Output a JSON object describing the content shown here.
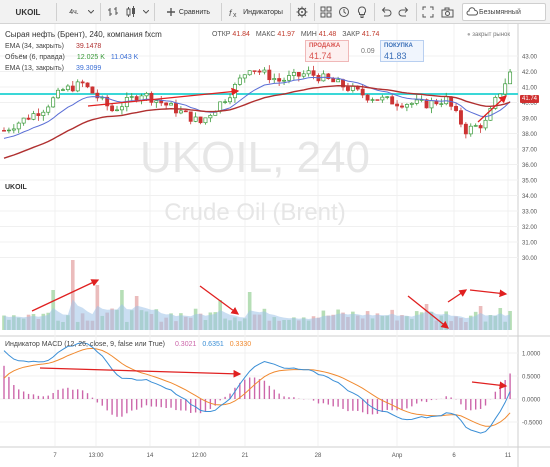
{
  "toolbar": {
    "symbol": "UKOIL",
    "interval": "4ч.",
    "compare": "Сравнить",
    "indicators": "Индикаторы",
    "unnamed": "Безымянный"
  },
  "main_pane": {
    "title": "Сырая нефть (Брент), 240, компания fxcm",
    "ohlc_open_label": "ОТКР",
    "ohlc_open": "41.84",
    "ohlc_high_label": "МАКС",
    "ohlc_high": "41.97",
    "ohlc_low_label": "МИН",
    "ohlc_low": "41.48",
    "ohlc_close_label": "ЗАКР",
    "ohlc_close": "41.74",
    "ema34_label": "EMA (34, закрыть)",
    "ema34_value": "39.1478",
    "volume_label": "Объём (6, правда)",
    "volume_value1": "12.025 K",
    "volume_value2": "11.043 K",
    "ema13_label": "EMA (13, закрыть)",
    "ema13_value": "39.3099",
    "sell_label": "ПРОДАЖА",
    "sell_price": "41.74",
    "spread": "0.09",
    "buy_label": "ПОКУПКА",
    "buy_price": "41.83",
    "market_status": "закрыт рынок",
    "last_price_tag": "41.74",
    "watermark_symbol": "UKOIL, 240",
    "watermark_name": "Crude Oil (Brent)",
    "symbol_tab": "UKOIL"
  },
  "macd_pane": {
    "label": "Индикатор MACD (12, 26, close, 9, false или True)",
    "value1": "0.3021",
    "value2": "0.6351",
    "value3": "0.3330"
  },
  "price_axis": [
    "43.00",
    "42.00",
    "41.00",
    "40.00",
    "39.00",
    "38.00",
    "37.00",
    "36.00",
    "35.00",
    "34.00",
    "33.00",
    "32.00",
    "31.00",
    "30.00"
  ],
  "macd_axis": [
    "1.0000",
    "0.5000",
    "0.0000",
    "-0.5000"
  ],
  "time_axis": [
    "7",
    "13:00",
    "14",
    "12:00",
    "21",
    "28",
    "Апр",
    "6",
    "11"
  ],
  "colors": {
    "up_candle": "#3a9a3a",
    "down_candle": "#cc3333",
    "ema13": "#5b6fd6",
    "ema34": "#b03030",
    "volume_up": "#a9d8a9",
    "volume_down": "#e8b0b0",
    "volume_ma": "#9ec2e8",
    "macd_line": "#3b8fd6",
    "signal_line": "#f08a30",
    "histogram": "#cc66aa",
    "cyan_level": "#3ad7d7",
    "arrow": "#e02020"
  },
  "icons": [
    "chevron-down-icon",
    "bar-style-icon",
    "candle-style-icon",
    "add-icon",
    "fx-icon",
    "settings-icon",
    "template-icon",
    "alert-icon",
    "bulb-icon",
    "undo-icon",
    "redo-icon",
    "fullscreen-icon",
    "camera-icon",
    "cloud-icon"
  ]
}
